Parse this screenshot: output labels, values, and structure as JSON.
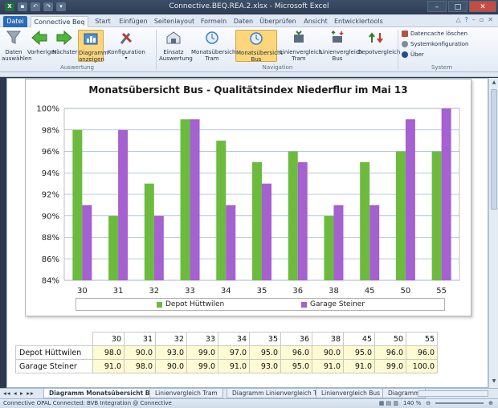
{
  "window": {
    "title": "Connective.BEQ.REA.2.xlsx - Microsoft Excel",
    "minimize_icon": "minimize-icon",
    "maximize_icon": "maximize-icon",
    "close_icon": "close-icon"
  },
  "ribbon_tabs": [
    {
      "label": "Datei"
    },
    {
      "label": "Connective Beq"
    },
    {
      "label": "Start"
    },
    {
      "label": "Einfügen"
    },
    {
      "label": "Seitenlayout"
    },
    {
      "label": "Formeln"
    },
    {
      "label": "Daten"
    },
    {
      "label": "Überprüfen"
    },
    {
      "label": "Ansicht"
    },
    {
      "label": "Entwicklertools"
    }
  ],
  "ribbon": {
    "groups": [
      {
        "label": "Auswertung",
        "buttons": [
          {
            "label": "Daten auswählen",
            "icon": "funnel-icon"
          },
          {
            "label": "Vorheriger",
            "icon": "arrow-left-icon"
          },
          {
            "label": "Nächster",
            "icon": "arrow-right-icon"
          },
          {
            "label": "Diagramm anzeigen",
            "icon": "chart-icon"
          },
          {
            "label": "Konfiguration",
            "icon": "tools-icon"
          }
        ]
      },
      {
        "label": "Navigation",
        "buttons": [
          {
            "label": "Einsatz Auswertung",
            "icon": "building-icon"
          },
          {
            "label": "Monatsübersicht Tram",
            "icon": "clock-icon"
          },
          {
            "label": "Monatsübersicht Bus",
            "icon": "clock-icon"
          },
          {
            "label": "Linienvergleich Tram",
            "icon": "compare-icon"
          },
          {
            "label": "Linienvergleich Bus",
            "icon": "compare-icon"
          },
          {
            "label": "Depotvergleich",
            "icon": "depot-icon"
          }
        ]
      },
      {
        "label": "System",
        "items": [
          {
            "label": "Datencache löschen",
            "icon": "cache-icon"
          },
          {
            "label": "Systemkonfiguration",
            "icon": "gear-icon"
          },
          {
            "label": "Über",
            "icon": "info-icon"
          }
        ]
      }
    ]
  },
  "chart_data": {
    "type": "bar",
    "title": "Monatsübersicht Bus - Qualitätsindex Niederflur im Mai 13",
    "categories": [
      "30",
      "31",
      "32",
      "33",
      "34",
      "35",
      "36",
      "38",
      "45",
      "50",
      "55"
    ],
    "series": [
      {
        "name": "Depot Hüttwilen",
        "color": "#6cbb3f",
        "values": [
          98.0,
          90.0,
          93.0,
          99.0,
          97.0,
          95.0,
          96.0,
          90.0,
          95.0,
          96.0,
          96.0
        ]
      },
      {
        "name": "Garage Steiner",
        "color": "#a461cf",
        "values": [
          91.0,
          98.0,
          90.0,
          99.0,
          91.0,
          93.0,
          95.0,
          91.0,
          91.0,
          99.0,
          100.0
        ]
      }
    ],
    "ylim": [
      84,
      100
    ],
    "yticks": [
      "84%",
      "86%",
      "88%",
      "90%",
      "92%",
      "94%",
      "96%",
      "98%",
      "100%"
    ],
    "grid": true,
    "legend": "bottom"
  },
  "table": {
    "header": [
      "30",
      "31",
      "32",
      "33",
      "34",
      "35",
      "36",
      "38",
      "45",
      "50",
      "55"
    ],
    "rows": [
      {
        "label": "Depot Hüttwilen",
        "values": [
          "98.0",
          "90.0",
          "93.0",
          "99.0",
          "97.0",
          "95.0",
          "96.0",
          "90.0",
          "95.0",
          "96.0",
          "96.0"
        ]
      },
      {
        "label": "Garage Steiner",
        "values": [
          "91.0",
          "98.0",
          "90.0",
          "99.0",
          "91.0",
          "93.0",
          "95.0",
          "91.0",
          "91.0",
          "99.0",
          "100.0"
        ]
      }
    ]
  },
  "sheet_tabs": [
    {
      "label": "Diagramm Monatsübersicht Bus"
    },
    {
      "label": "Linienvergleich Tram"
    },
    {
      "label": "Diagramm Linienvergleich Tram"
    },
    {
      "label": "Linienvergleich Bus"
    },
    {
      "label": "Diagramm"
    }
  ],
  "status": {
    "text": "Connective OPAL Connected: BVB Integration @ Connective",
    "zoom": "140 %"
  }
}
